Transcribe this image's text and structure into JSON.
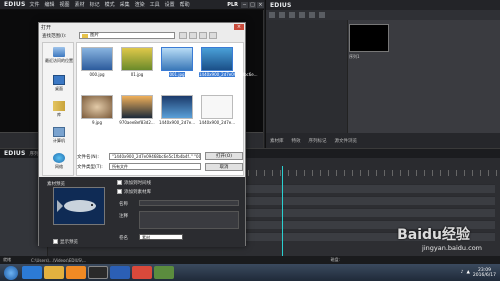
{
  "app": {
    "logo": "EDIUS",
    "menu": [
      "文件",
      "编辑",
      "视图",
      "素材",
      "标记",
      "模式",
      "采集",
      "渲染",
      "工具",
      "设置",
      "帮助"
    ],
    "player_label": "PLR",
    "window_buttons": [
      "−",
      "□",
      "×"
    ]
  },
  "bin": {
    "logo": "EDIUS",
    "path": "",
    "thumb_label": "序列1",
    "tabs": [
      "素材库",
      "特效",
      "序列标记",
      "源文件浏览"
    ]
  },
  "timeline": {
    "logo": "EDIUS",
    "title": "序列1",
    "playhead_color": "#2ad0d0"
  },
  "dialog": {
    "title": "打开",
    "look_in_label": "查找范围(I):",
    "look_in_value": "图片",
    "close": "×",
    "places": [
      {
        "label": "最近访问的位置",
        "icon": "recent-icon"
      },
      {
        "label": "桌面",
        "icon": "desktop-icon"
      },
      {
        "label": "库",
        "icon": "library-icon"
      },
      {
        "label": "计算机",
        "icon": "computer-icon"
      },
      {
        "label": "网络",
        "icon": "network-icon"
      }
    ],
    "files": [
      {
        "name": "000.jpg",
        "selected": false,
        "color": "#3b6aa8"
      },
      {
        "name": "01.jpg",
        "selected": false,
        "color": "#b8a23a"
      },
      {
        "name": "001.jpg",
        "selected": true,
        "color": "#5a8fc4"
      },
      {
        "name": "1440x900_2d7e09468bc6e...",
        "selected": true,
        "color": "#2f7dba"
      },
      {
        "name": "9.jpg",
        "selected": false,
        "color": "#8a6a4a"
      },
      {
        "name": "970aee8ef83d2...",
        "selected": false,
        "color": "#2a2a2a"
      },
      {
        "name": "1440x900_2d7e...",
        "selected": false,
        "color": "#2c6fa8"
      },
      {
        "name": "1440x900_2d7e...",
        "selected": false,
        "color": "#d8d8d8"
      }
    ],
    "filename_label": "文件名(N):",
    "filename_value": "\"1440x900_2d7e09468bc6e5c1fb4b4f..\" \"001.jpg\"",
    "filetype_label": "文件类型(T):",
    "filetype_value": "所有文件",
    "open_button": "打开(O)",
    "cancel_button": "取消",
    "preview_label": "素材预览",
    "check1_label": "添加到时间线",
    "check2_label": "添加到素材库",
    "clip_name_label": "名称",
    "comment_label": "注释",
    "reel_label": "卷名",
    "reel_value": "素材",
    "bottom_check_label": "显示预览"
  },
  "status": {
    "left": "就绪",
    "middle": "C:\\Users\\...\\Videos\\EDIUS\\...",
    "right": "磁盘:"
  },
  "taskbar": {
    "apps": [
      "ie-icon",
      "explorer-icon",
      "media-icon",
      "edius-icon",
      "word-icon",
      "chrome-icon",
      "misc-icon"
    ],
    "app_colors": [
      "#2c7bd6",
      "#e3b13f",
      "#f08a24",
      "#2a2a2a",
      "#2b5fb5",
      "#d9493b",
      "#5b8c3e"
    ],
    "time": "23:09",
    "date": "2016/6/17"
  },
  "watermark": {
    "brand": "Baidu经验",
    "url": "jingyan.baidu.com"
  }
}
